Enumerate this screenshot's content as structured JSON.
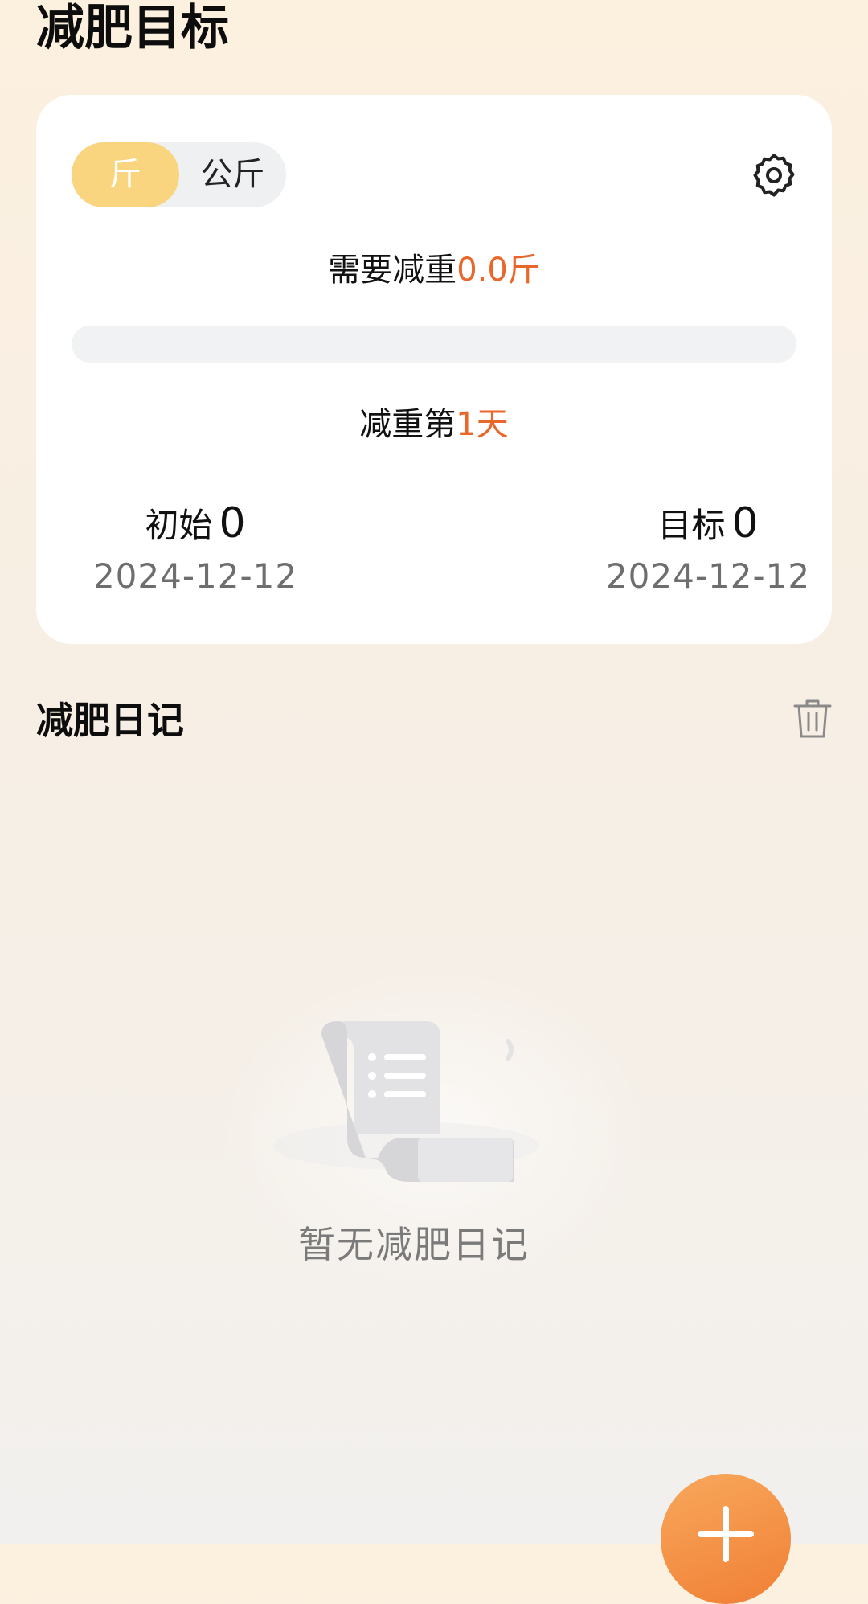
{
  "page": {
    "title": "减肥目标"
  },
  "goal_card": {
    "unit_toggle": {
      "options": [
        "斤",
        "公斤"
      ],
      "selected": "斤"
    },
    "need_loss": {
      "prefix": "需要减重",
      "value": "0.0斤"
    },
    "progress": 0,
    "day_count": {
      "prefix": "减重第",
      "value": "1天"
    },
    "initial": {
      "label": "初始",
      "value": "0",
      "date": "2024-12-12"
    },
    "target": {
      "label": "目标",
      "value": "0",
      "date": "2024-12-12"
    }
  },
  "diary": {
    "title": "减肥日记",
    "empty_text": "暂无减肥日记"
  },
  "icons": {
    "settings": "gear-icon",
    "delete": "trash-icon",
    "add": "plus-icon",
    "empty_state": "scroll-list-icon"
  },
  "colors": {
    "accent": "#e9672a",
    "toggle_active": "#f9d57f",
    "fab": "#f07f35"
  }
}
